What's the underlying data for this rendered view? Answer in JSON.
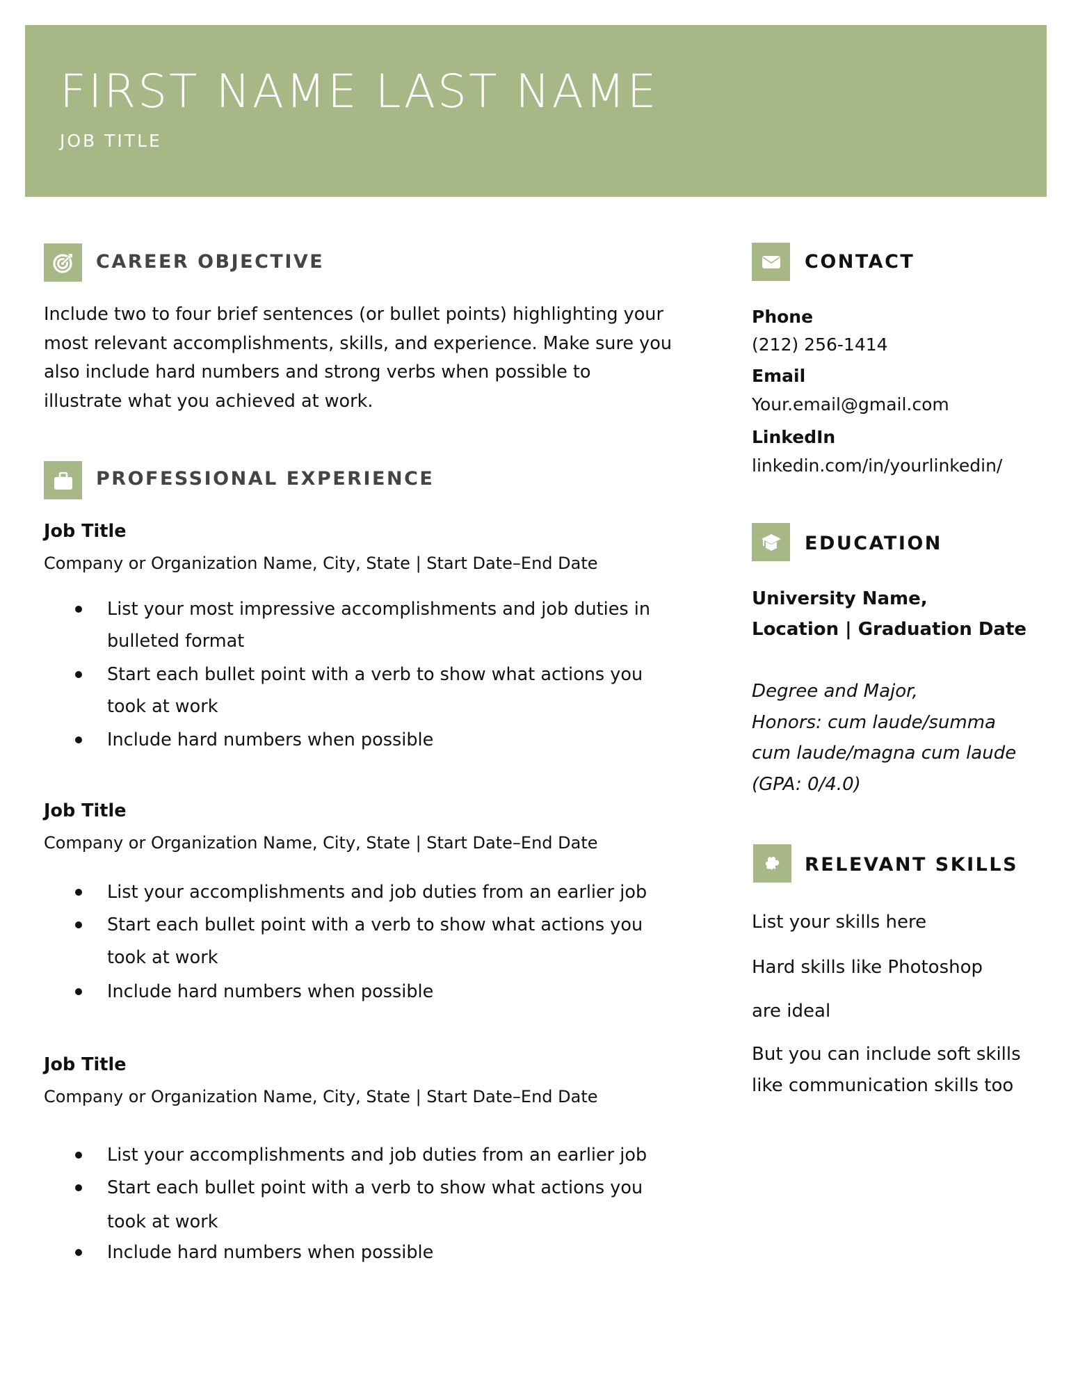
{
  "header": {
    "name": "FIRST NAME LAST NAME",
    "job_title": "JOB TITLE",
    "accent_color": "#a7b785"
  },
  "career_objective": {
    "heading": "CAREER OBJECTIVE",
    "icon": "target-icon",
    "lines": [
      "Include two to four brief sentences (or bullet points) highlighting your",
      "most relevant accomplishments, skills, and experience. Make sure you",
      "also include hard numbers and strong verbs when possible to",
      "illustrate what you achieved at work."
    ]
  },
  "experience": {
    "heading": "PROFESSIONAL EXPERIENCE",
    "icon": "briefcase-icon",
    "jobs": [
      {
        "title": "Job Title",
        "company": "Company or Organization Name, City, State | Start Date–End Date",
        "bullet_lines": [
          {
            "bullet": true,
            "text": "List your most impressive accomplishments and job duties in"
          },
          {
            "bullet": false,
            "text": "bulleted format"
          },
          {
            "bullet": true,
            "text": "Start each bullet point with a verb to show what actions you"
          },
          {
            "bullet": false,
            "text": "took at work"
          },
          {
            "bullet": true,
            "text": "Include hard numbers when possible"
          }
        ]
      },
      {
        "title": "Job Title",
        "company": "Company or Organization Name, City, State | Start Date–End Date",
        "bullet_lines": [
          {
            "bullet": true,
            "text": "List your accomplishments and job duties from an earlier job"
          },
          {
            "bullet": true,
            "text": "Start each bullet point with a verb to show what actions you"
          },
          {
            "bullet": false,
            "text": "took at work"
          },
          {
            "bullet": true,
            "text": "Include hard numbers when possible"
          }
        ]
      },
      {
        "title": "Job Title",
        "company": "Company or Organization Name, City, State | Start Date–End Date",
        "bullet_lines": [
          {
            "bullet": true,
            "text": "List your accomplishments and job duties from an earlier job"
          },
          {
            "bullet": true,
            "text": "Start each bullet point with a verb to show what actions you"
          },
          {
            "bullet": false,
            "text": "took at work"
          },
          {
            "bullet": true,
            "text": "Include hard numbers when possible"
          }
        ]
      }
    ]
  },
  "contact": {
    "heading": "CONTACT",
    "icon": "envelope-icon",
    "phone_label": "Phone",
    "phone": "(212) 256-1414",
    "email_label": "Email",
    "email": "Your.email@gmail.com",
    "linkedin_label": "LinkedIn",
    "linkedin": "linkedin.com/in/yourlinkedin/"
  },
  "education": {
    "heading": "EDUCATION",
    "icon": "graduation-cap-icon",
    "university_line1": "University Name,",
    "university_line2": "Location | Graduation Date",
    "degree_lines": [
      "Degree and Major,",
      "Honors: cum laude/summa",
      "cum laude/magna cum laude",
      "(GPA: 0/4.0)"
    ]
  },
  "skills": {
    "heading": "RELEVANT SKILLS",
    "icon": "puzzle-piece-icon",
    "lines": [
      "List your skills here",
      "Hard skills like Photoshop",
      "are ideal",
      "But you can include soft skills",
      "like communication skills too"
    ]
  }
}
